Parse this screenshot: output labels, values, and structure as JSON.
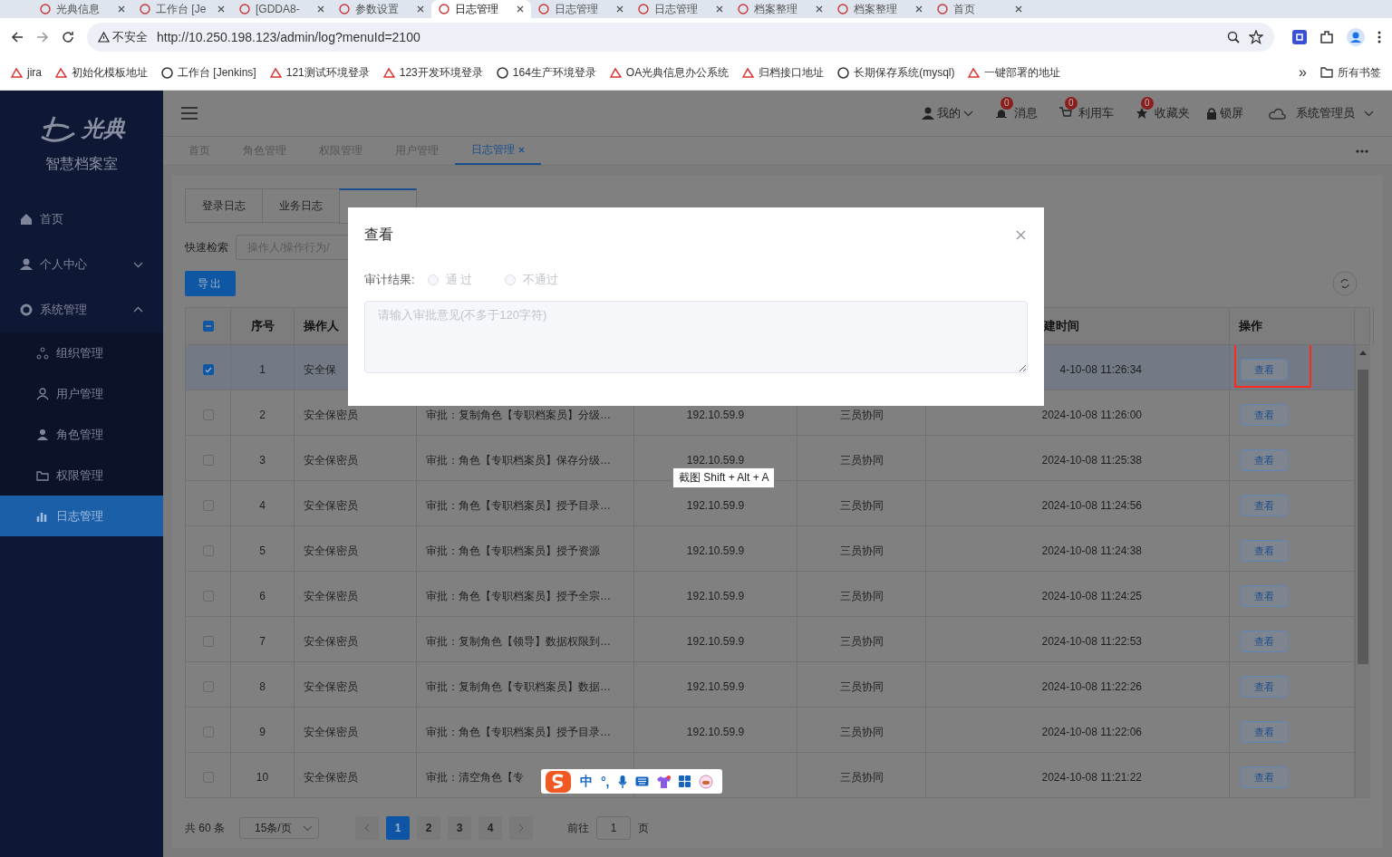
{
  "browser": {
    "tabs": [
      {
        "title": "光典信息",
        "selected": false
      },
      {
        "title": "工作台 [Je",
        "selected": false
      },
      {
        "title": "[GDDA8-",
        "selected": false
      },
      {
        "title": "参数设置",
        "selected": false
      },
      {
        "title": "日志管理",
        "selected": true
      },
      {
        "title": "日志管理",
        "selected": false
      },
      {
        "title": "日志管理",
        "selected": false
      },
      {
        "title": "档案整理",
        "selected": false
      },
      {
        "title": "档案整理",
        "selected": false
      },
      {
        "title": "首页",
        "selected": false
      }
    ],
    "security": "不安全",
    "url": "http://10.250.198.123/admin/log?menuId=2100",
    "bookmarks": [
      "jira",
      "初始化模板地址",
      "工作台 [Jenkins]",
      "121测试环境登录",
      "123开发环境登录",
      "164生产环境登录",
      "OA光典信息办公系统",
      "归档接口地址",
      "长期保存系统(mysql)",
      "一键部署的地址"
    ],
    "more": "»",
    "all_bookmarks": "所有书签"
  },
  "sidebar": {
    "logo": "光典",
    "subtitle": "智慧档案室",
    "items": [
      {
        "label": "首页",
        "selected": false
      },
      {
        "label": "个人中心",
        "expanded": false,
        "selected": false
      },
      {
        "label": "系统管理",
        "expanded": true,
        "selected": false,
        "children": [
          {
            "label": "组织管理",
            "selected": false
          },
          {
            "label": "用户管理",
            "selected": false
          },
          {
            "label": "角色管理",
            "selected": false
          },
          {
            "label": "权限管理",
            "selected": false
          },
          {
            "label": "日志管理",
            "selected": true
          }
        ]
      }
    ]
  },
  "header": {
    "mine": "我的",
    "counters": [
      {
        "label": "消息",
        "badge": "0"
      },
      {
        "label": "利用车",
        "badge": "0"
      },
      {
        "label": "收藏夹",
        "badge": "0"
      }
    ],
    "lock": "锁屏",
    "user": "系统管理员"
  },
  "page_tabs": [
    {
      "label": "首页",
      "selected": false
    },
    {
      "label": "角色管理",
      "selected": false
    },
    {
      "label": "权限管理",
      "selected": false
    },
    {
      "label": "用户管理",
      "selected": false
    },
    {
      "label": "日志管理",
      "selected": true
    }
  ],
  "log_tabs": [
    {
      "label": "登录日志",
      "selected": false
    },
    {
      "label": "业务日志",
      "selected": false
    },
    {
      "selected": true
    }
  ],
  "search": {
    "label": "快速检索",
    "placeholder": "操作人/操作行为/"
  },
  "export": "导出",
  "table": {
    "select_all_partial": true,
    "columns": {
      "no": "序号",
      "operator": "操作人",
      "time": "建时间",
      "action": "操作"
    },
    "rows": [
      {
        "selected": true,
        "checked": true,
        "highlighted": true,
        "no": "1",
        "operator": "安全保",
        "time": "4-10-08 11:26:34",
        "action": "查看"
      },
      {
        "selected": false,
        "checked": false,
        "highlighted": false,
        "no": "2",
        "operator": "安全保密员",
        "behavior": "审批：复制角色【专职档案员】分级…",
        "ip": "192.10.59.9",
        "type": "三员协同",
        "time": "2024-10-08 11:26:00",
        "action": "查看"
      },
      {
        "selected": false,
        "checked": false,
        "highlighted": false,
        "no": "3",
        "operator": "安全保密员",
        "behavior": "审批：角色【专职档案员】保存分级…",
        "ip": "192.10.59.9",
        "type": "三员协同",
        "time": "2024-10-08 11:25:38",
        "action": "查看"
      },
      {
        "selected": false,
        "checked": false,
        "highlighted": false,
        "no": "4",
        "operator": "安全保密员",
        "behavior": "审批：角色【专职档案员】授予目录…",
        "ip": "192.10.59.9",
        "type": "三员协同",
        "time": "2024-10-08 11:24:56",
        "action": "查看"
      },
      {
        "selected": false,
        "checked": false,
        "highlighted": false,
        "no": "5",
        "operator": "安全保密员",
        "behavior": "审批：角色【专职档案员】授予资源",
        "ip": "192.10.59.9",
        "type": "三员协同",
        "time": "2024-10-08 11:24:38",
        "action": "查看"
      },
      {
        "selected": false,
        "checked": false,
        "highlighted": false,
        "no": "6",
        "operator": "安全保密员",
        "behavior": "审批：角色【专职档案员】授予全宗…",
        "ip": "192.10.59.9",
        "type": "三员协同",
        "time": "2024-10-08 11:24:25",
        "action": "查看"
      },
      {
        "selected": false,
        "checked": false,
        "highlighted": false,
        "no": "7",
        "operator": "安全保密员",
        "behavior": "审批：复制角色【领导】数据权限到…",
        "ip": "192.10.59.9",
        "type": "三员协同",
        "time": "2024-10-08 11:22:53",
        "action": "查看"
      },
      {
        "selected": false,
        "checked": false,
        "highlighted": false,
        "no": "8",
        "operator": "安全保密员",
        "behavior": "审批：复制角色【专职档案员】数据…",
        "ip": "192.10.59.9",
        "type": "三员协同",
        "time": "2024-10-08 11:22:26",
        "action": "查看"
      },
      {
        "selected": false,
        "checked": false,
        "highlighted": false,
        "no": "9",
        "operator": "安全保密员",
        "behavior": "审批：角色【专职档案员】授予目录…",
        "ip": "192.10.59.9",
        "type": "三员协同",
        "time": "2024-10-08 11:22:06",
        "action": "查看"
      },
      {
        "selected": false,
        "checked": false,
        "highlighted": false,
        "no": "10",
        "operator": "安全保密员",
        "behavior": "审批：清空角色【专",
        "type": "三员协同",
        "time": "2024-10-08 11:21:22",
        "action": "查看"
      }
    ]
  },
  "pagination": {
    "total": "共 60 条",
    "page_size": "15条/页",
    "pages": [
      {
        "label": "1",
        "selected": true
      },
      {
        "label": "2",
        "selected": false
      },
      {
        "label": "3",
        "selected": false
      },
      {
        "label": "4",
        "selected": false
      }
    ],
    "goto": "前往",
    "goto_value": "1",
    "page_unit": "页"
  },
  "modal": {
    "title": "查看",
    "label": "审计结果:",
    "options": [
      {
        "label": "通 过",
        "selected": false
      },
      {
        "label": "不通过",
        "selected": false
      }
    ],
    "placeholder": "请输入审批意见(不多于120字符)"
  },
  "tooltip": "截图 Shift + Alt + A",
  "ime": {
    "mode": "中",
    "punct": "°,"
  }
}
